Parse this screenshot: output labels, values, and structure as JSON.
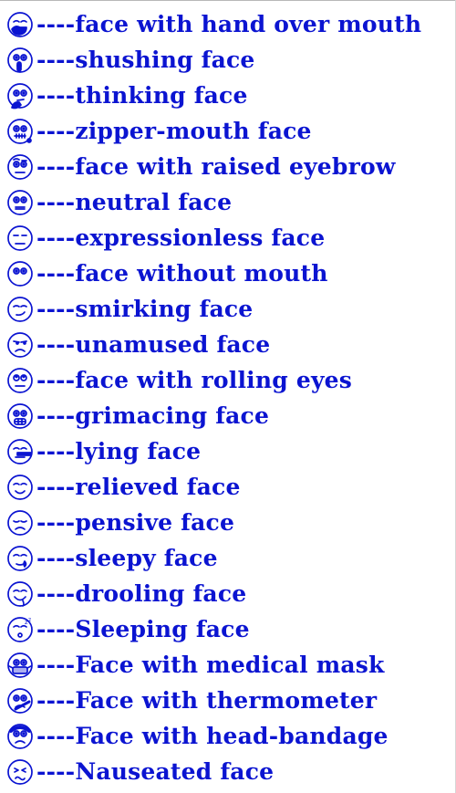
{
  "separator": "----",
  "items": [
    {
      "label": "face with hand over mouth",
      "icon": "face-with-hand-over-mouth-icon"
    },
    {
      "label": "shushing face",
      "icon": "shushing-face-icon"
    },
    {
      "label": "thinking face",
      "icon": "thinking-face-icon"
    },
    {
      "label": "zipper-mouth face",
      "icon": "zipper-mouth-face-icon"
    },
    {
      "label": "face with raised eyebrow",
      "icon": "face-with-raised-eyebrow-icon"
    },
    {
      "label": "neutral face",
      "icon": "neutral-face-icon"
    },
    {
      "label": "expressionless face",
      "icon": "expressionless-face-icon"
    },
    {
      "label": "face without mouth",
      "icon": "face-without-mouth-icon"
    },
    {
      "label": "smirking face",
      "icon": "smirking-face-icon"
    },
    {
      "label": "unamused face",
      "icon": "unamused-face-icon"
    },
    {
      "label": "face with rolling eyes",
      "icon": "face-with-rolling-eyes-icon"
    },
    {
      "label": "grimacing face",
      "icon": "grimacing-face-icon"
    },
    {
      "label": "lying face",
      "icon": "lying-face-icon"
    },
    {
      "label": "relieved face",
      "icon": "relieved-face-icon"
    },
    {
      "label": "pensive face",
      "icon": "pensive-face-icon"
    },
    {
      "label": "sleepy face",
      "icon": "sleepy-face-icon"
    },
    {
      "label": "drooling face",
      "icon": "drooling-face-icon"
    },
    {
      "label": "Sleeping face",
      "icon": "sleeping-face-icon"
    },
    {
      "label": "Face with medical mask",
      "icon": "face-with-medical-mask-icon"
    },
    {
      "label": "Face with thermometer",
      "icon": "face-with-thermometer-icon"
    },
    {
      "label": "Face with head-bandage",
      "icon": "face-with-head-bandage-icon"
    },
    {
      "label": "Nauseated face",
      "icon": "nauseated-face-icon"
    }
  ],
  "colors": {
    "text": "#0b14d1",
    "icon_stroke": "#0b14d1",
    "background": "#ffffff"
  }
}
